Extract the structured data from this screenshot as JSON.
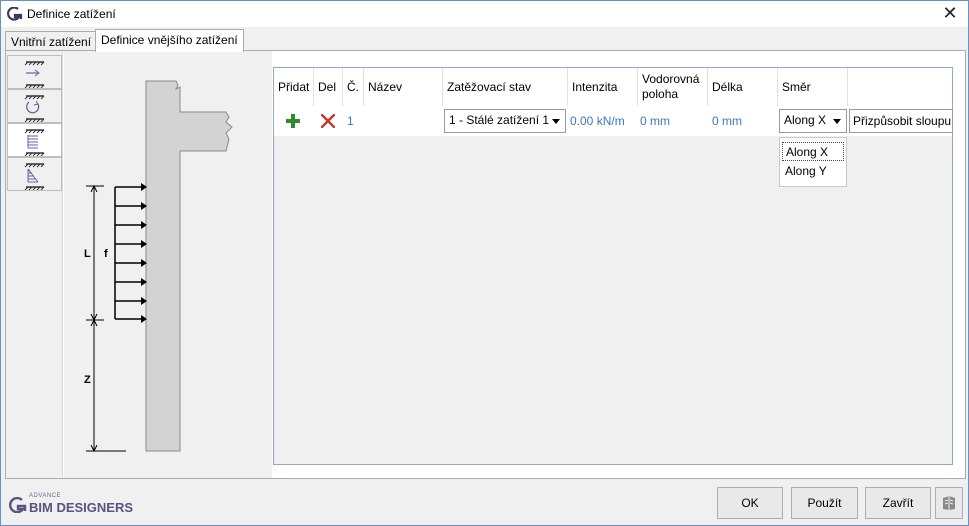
{
  "window": {
    "title": "Definice zatížení",
    "close_symbol": "✕"
  },
  "tabs": [
    {
      "label": "Vnitřní zatížení",
      "active": false
    },
    {
      "label": "Definice vnějšího zatížení",
      "active": true
    }
  ],
  "support_types": [
    {
      "icon": "support-type-1-icon",
      "active": false
    },
    {
      "icon": "support-type-2-icon",
      "active": false
    },
    {
      "icon": "support-type-3-icon",
      "active": true
    },
    {
      "icon": "support-type-4-icon",
      "active": false
    }
  ],
  "drawing": {
    "label_L": "L",
    "label_f": "f",
    "label_Z": "Z"
  },
  "table": {
    "headers": {
      "add": "Přidat",
      "del": "Del",
      "no": "Č.",
      "name": "Název",
      "loadcase": "Zatěžovací stav",
      "intensity": "Intenzita",
      "hpos": "Vodorovná poloha",
      "length": "Délka",
      "direction": "Směr"
    },
    "rows": [
      {
        "no": "1",
        "name": "",
        "loadcase": "1 - Stálé zatížení 1",
        "intensity": "0.00 kN/m",
        "hpos": "0 mm",
        "length": "0 mm",
        "direction": "Along X",
        "fit_button": "Přizpůsobit sloupu"
      }
    ],
    "direction_options": [
      "Along X",
      "Along Y"
    ]
  },
  "footer": {
    "logo_small": "ADVANCE",
    "logo_main": "BIM DESIGNERS",
    "ok": "OK",
    "apply": "Použít",
    "close": "Zavřít"
  },
  "colors": {
    "add_icon": "#2e8b2e",
    "delete_icon": "#c0392b",
    "value_blue": "#3a78c3",
    "border_blue": "#8fa8cf",
    "logo_purple": "#5b5380"
  }
}
